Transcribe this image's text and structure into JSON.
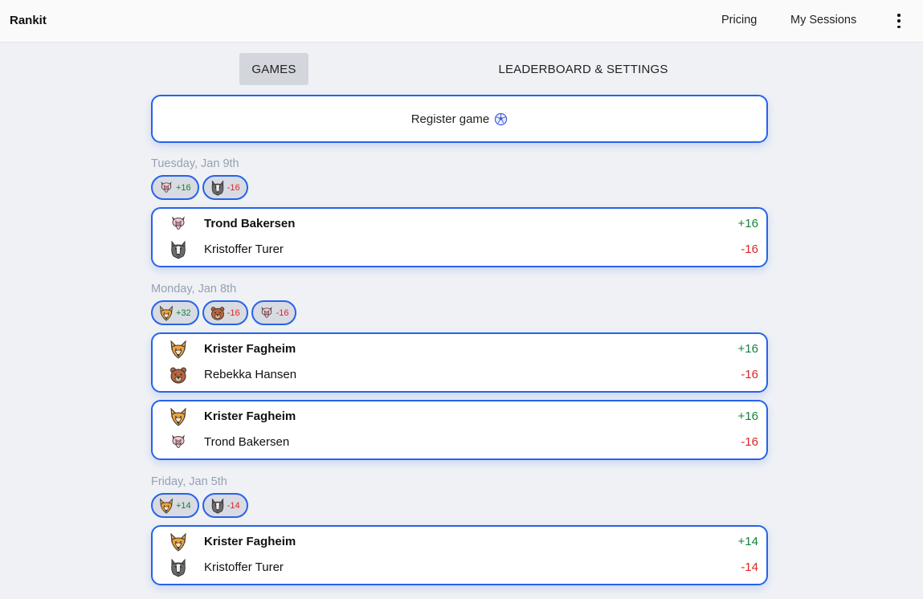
{
  "header": {
    "brand": "Rankit",
    "nav": {
      "pricing": "Pricing",
      "sessions": "My Sessions"
    }
  },
  "tabs": {
    "games": "GAMES",
    "leaderboard": "LEADERBOARD & SETTINGS",
    "active": "games"
  },
  "register": {
    "label": "Register game",
    "icon": "soccer-ball-icon"
  },
  "colors": {
    "accent": "#2563eb",
    "positive": "#15803d",
    "negative": "#dc2626",
    "day_label": "#96a0b3"
  },
  "days": [
    {
      "label": "Tuesday, Jan 9th",
      "chips": [
        {
          "avatar": "pig-icon",
          "delta": "+16"
        },
        {
          "avatar": "wolf-icon",
          "delta": "-16"
        }
      ],
      "games": [
        {
          "winner": {
            "avatar": "pig-icon",
            "name": "Trond Bakersen",
            "delta": "+16"
          },
          "loser": {
            "avatar": "wolf-icon",
            "name": "Kristoffer Turer",
            "delta": "-16"
          }
        }
      ]
    },
    {
      "label": "Monday, Jan 8th",
      "chips": [
        {
          "avatar": "fox-icon",
          "delta": "+32"
        },
        {
          "avatar": "bear-icon",
          "delta": "-16"
        },
        {
          "avatar": "pig-icon",
          "delta": "-16"
        }
      ],
      "games": [
        {
          "winner": {
            "avatar": "fox-icon",
            "name": "Krister Fagheim",
            "delta": "+16"
          },
          "loser": {
            "avatar": "bear-icon",
            "name": "Rebekka Hansen",
            "delta": "-16"
          }
        },
        {
          "winner": {
            "avatar": "fox-icon",
            "name": "Krister Fagheim",
            "delta": "+16"
          },
          "loser": {
            "avatar": "pig-icon",
            "name": "Trond Bakersen",
            "delta": "-16"
          }
        }
      ]
    },
    {
      "label": "Friday, Jan 5th",
      "chips": [
        {
          "avatar": "fox-icon",
          "delta": "+14"
        },
        {
          "avatar": "wolf-icon",
          "delta": "-14"
        }
      ],
      "games": [
        {
          "winner": {
            "avatar": "fox-icon",
            "name": "Krister Fagheim",
            "delta": "+14"
          },
          "loser": {
            "avatar": "wolf-icon",
            "name": "Kristoffer Turer",
            "delta": "-14"
          }
        }
      ]
    }
  ]
}
